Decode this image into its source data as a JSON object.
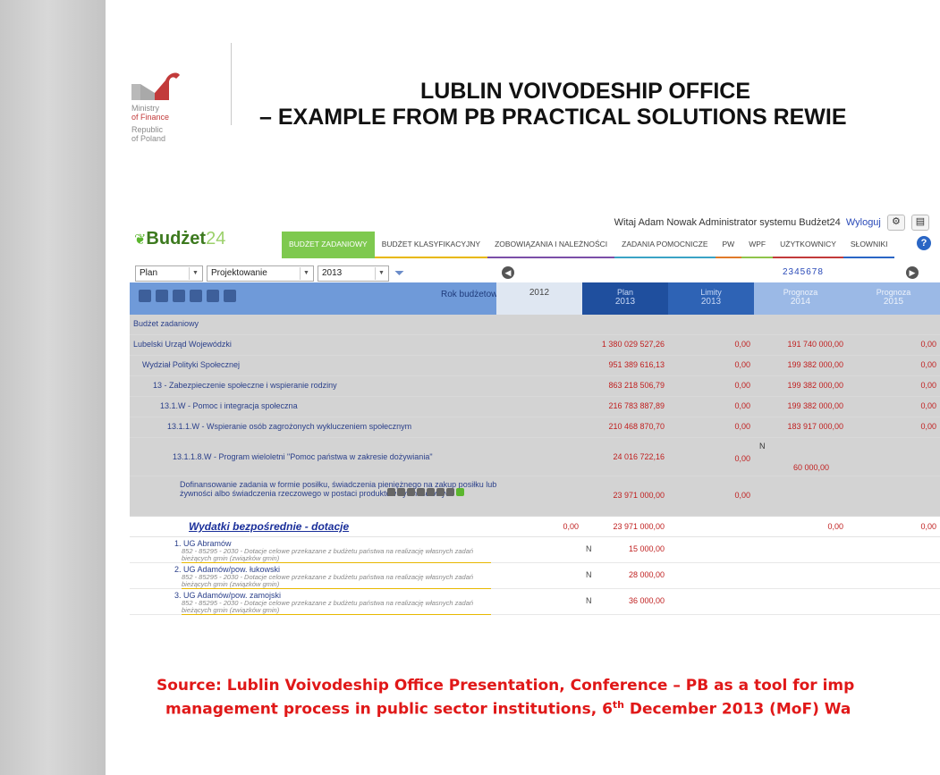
{
  "colors": {
    "accent_green": "#7ec94f",
    "header_blue": "#6f9ad9",
    "plan_blue": "#1f4f9e",
    "value_red": "#c02020",
    "source_red": "#e01818"
  },
  "logo": {
    "line1": "Ministry",
    "line2": "of Finance",
    "line3": "Republic",
    "line4": "of Poland"
  },
  "slide": {
    "title_line1": "LUBLIN VOIVODESHIP OFFICE",
    "title_line2": "– EXAMPLE FROM PB PRACTICAL SOLUTIONS REWIE",
    "source_line1": "Source: Lublin Voivodeship Office Presentation, Conference – PB as a tool for imp",
    "source_line2a": "management process in public sector institutions, 6",
    "source_sup": "th",
    "source_line2b": " December 2013 (MoF) Wa"
  },
  "app": {
    "welcome": "Witaj Adam Nowak Administrator systemu Budżet24",
    "logout": "Wyloguj",
    "brand_a": "Budżet",
    "brand_b": "24",
    "help": "?",
    "nav": [
      "BUDŻET ZADANIOWY",
      "BUDŻET KLASYFIKACYJNY",
      "ZOBOWIĄZANIA I NALEŻNOŚCI",
      "ZADANIA POMOCNICZE",
      "PW",
      "WPF",
      "UŻYTKOWNICY",
      "SŁOWNIKI"
    ],
    "filters": {
      "plan": "Plan",
      "mode": "Projektowanie budżetu",
      "year": "2013"
    },
    "pages": "2345678",
    "header": {
      "rok": "Rok budżetowy",
      "y2012": "2012",
      "plan_label": "Plan",
      "plan_year": "2013",
      "limit_label": "Limity",
      "limit_year": "2013",
      "p14_label": "Prognoza",
      "p14_year": "2014",
      "p15_label": "Prognoza",
      "p15_year": "2015"
    },
    "rows": [
      {
        "label": "Budżet zadaniowy",
        "plan": "",
        "limit": "",
        "p14": "",
        "p15": ""
      },
      {
        "label": "Lubelski Urząd Wojewódzki",
        "plan": "1 380 029 527,26",
        "limit": "0,00",
        "p14": "191 740 000,00",
        "p15": "0,00"
      },
      {
        "label": "Wydział Polityki Społecznej",
        "plan": "951 389 616,13",
        "limit": "0,00",
        "p14": "199 382 000,00",
        "p15": "0,00"
      },
      {
        "label": "13 - Zabezpieczenie społeczne i wspieranie rodziny",
        "plan": "863 218 506,79",
        "limit": "0,00",
        "p14": "199 382 000,00",
        "p15": "0,00"
      },
      {
        "label": "13.1.W - Pomoc i integracja społeczna",
        "plan": "216 783 887,89",
        "limit": "0,00",
        "p14": "199 382 000,00",
        "p15": "0,00"
      },
      {
        "label": "13.1.1.W - Wspieranie osób zagrożonych wykluczeniem społecznym",
        "plan": "210 468 870,70",
        "limit": "0,00",
        "p14": "183 917 000,00",
        "p15": "0,00"
      }
    ],
    "program": {
      "label": "13.1.1.8.W - Program wieloletni \"Pomoc państwa w zakresie dożywiania\"",
      "plan": "24 016 722,16",
      "limit": "0,00",
      "flag": "N",
      "p14": "60 000,00"
    },
    "dofin": {
      "label_l1": "Dofinansowanie zadania w formie posiłku, świadczenia pieniężnego na zakup posiłku lub",
      "label_l2": "żywności albo świadczenia rzeczowego w postaci produktów żywnościowych",
      "plan": "23 971 000,00",
      "limit": "0,00"
    },
    "wydatki": {
      "title": "Wydatki bezpośrednie - dotacje",
      "y2012": "0,00",
      "plan": "23 971 000,00",
      "p14": "0,00",
      "p15": "0,00"
    },
    "items": [
      {
        "name": "1. UG Abramów",
        "desc": "852 - 85295 - 2030 - Dotacje celowe przekazane z budżetu państwa na realizację własnych zadań bieżących gmin (związków gmin)",
        "flag": "N",
        "value": "15 000,00"
      },
      {
        "name": "2. UG Adamów/pow. łukowski",
        "desc": "852 - 85295 - 2030 - Dotacje celowe przekazane z budżetu państwa na realizację własnych zadań bieżących gmin (związków gmin)",
        "flag": "N",
        "value": "28 000,00"
      },
      {
        "name": "3. UG Adamów/pow. zamojski",
        "desc": "852 - 85295 - 2030 - Dotacje celowe przekazane z budżetu państwa na realizację własnych zadań bieżących gmin (związków gmin)",
        "flag": "N",
        "value": "36 000,00"
      }
    ]
  }
}
